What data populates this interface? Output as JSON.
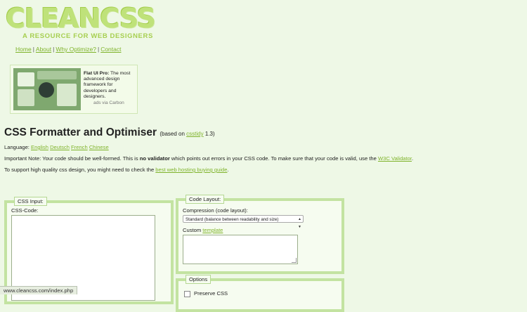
{
  "logo": {
    "word": "CLEANCSS",
    "tagline": "A RESOURCE FOR WEB DESIGNERS"
  },
  "nav": {
    "items": [
      "Home",
      "About",
      "Why Optimize?",
      "Contact"
    ],
    "separator": "|"
  },
  "ad": {
    "title": "Flat UI Pro:",
    "body": " The most advanced design framework for developers and designers.",
    "via": "ads via Carbon"
  },
  "header": {
    "title": "CSS Formatter and Optimiser",
    "based_prefix": "(based on ",
    "based_link": "csstidy",
    "based_suffix": " 1.3)"
  },
  "language": {
    "label": "Language:",
    "options": [
      "English",
      "Deutsch",
      "French",
      "Chinese"
    ]
  },
  "note": {
    "prefix": "Important Note: Your code should be well-formed. This is ",
    "bold": "no validator",
    "middle": " which points out errors in your CSS code. To make sure that your code is valid, use the ",
    "link": "W3C Validator",
    "suffix": "."
  },
  "support": {
    "prefix": "To support high quality css design, you might need to check the ",
    "link": "best web hosting buying guide",
    "suffix": "."
  },
  "css_input": {
    "legend": "CSS Input:",
    "code_label": "CSS-Code:"
  },
  "code_layout": {
    "legend": "Code Layout:",
    "compression_label": "Compression (code layout):",
    "compression_value": "Standard (balance between readability and size)",
    "custom_label": "Custom ",
    "template_link": "template"
  },
  "options": {
    "legend": "Options",
    "preserve_label": "Preserve CSS"
  },
  "status_bar": {
    "url": "www.cleancss.com/index.php"
  }
}
